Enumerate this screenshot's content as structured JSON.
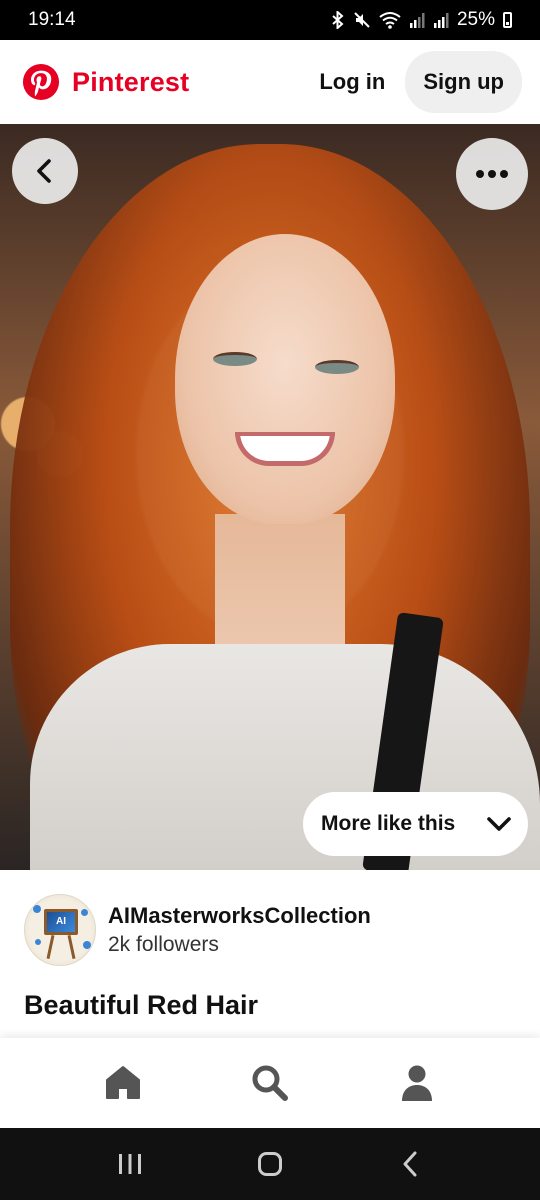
{
  "status_bar": {
    "time": "19:14",
    "battery": "25%",
    "icons": [
      "bluetooth-icon",
      "mute-icon",
      "wifi-icon",
      "signal-icon",
      "signal-icon",
      "battery-icon"
    ]
  },
  "header": {
    "brand": "Pinterest",
    "login_label": "Log in",
    "signup_label": "Sign up",
    "brand_color": "#e60023"
  },
  "pin": {
    "more_like_label": "More like this",
    "title": "Beautiful Red Hair"
  },
  "creator": {
    "name": "AIMasterworksCollection",
    "followers": "2k followers",
    "avatar_text": "AI"
  },
  "bottom_nav": {
    "items": [
      "home-icon",
      "search-icon",
      "profile-icon"
    ]
  },
  "system_nav": {
    "items": [
      "recents-icon",
      "home-button-icon",
      "back-icon"
    ]
  }
}
